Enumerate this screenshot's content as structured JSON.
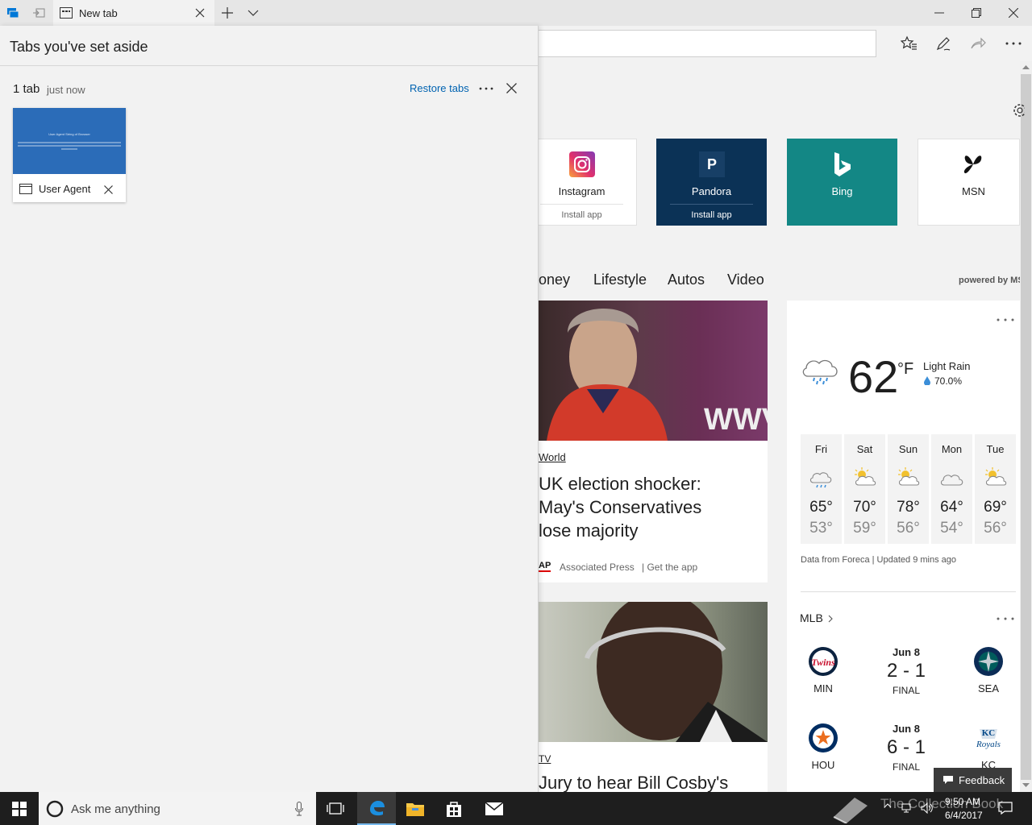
{
  "browser": {
    "tab_title": "New tab",
    "window_buttons": [
      "minimize",
      "restore",
      "close"
    ]
  },
  "aside_panel": {
    "title": "Tabs you've set aside",
    "group_count": "1 tab",
    "group_time": "just now",
    "restore_label": "Restore tabs",
    "more_label": "⋯",
    "thumbnail_title": "User Agent",
    "thumbnail_heading": "User Agent String of Browser"
  },
  "top_sites": [
    {
      "name": "Instagram",
      "sub": "Install app"
    },
    {
      "name": "Pandora",
      "sub": "Install app"
    },
    {
      "name": "Bing",
      "sub": ""
    },
    {
      "name": "MSN",
      "sub": ""
    }
  ],
  "news_nav": {
    "items": [
      "oney",
      "Lifestyle",
      "Autos",
      "Video"
    ],
    "powered_by": "powered by MS"
  },
  "articles": [
    {
      "category": "World",
      "headline_lines": [
        "UK election shocker:",
        "May's Conservatives",
        "lose majority"
      ],
      "source_logo": "AP",
      "source": "Associated Press",
      "get_app": "| Get the app"
    },
    {
      "category": "TV",
      "headline_lines": [
        "Jury to hear Bill Cosby's"
      ]
    }
  ],
  "weather": {
    "temp": "62",
    "unit": "°F",
    "condition": "Light Rain",
    "precip": "70.0%",
    "forecast": [
      {
        "day": "Fri",
        "icon": "rain-icon",
        "high": "65°",
        "low": "53°"
      },
      {
        "day": "Sat",
        "icon": "partly-sunny-icon",
        "high": "70°",
        "low": "59°"
      },
      {
        "day": "Sun",
        "icon": "partly-sunny-icon",
        "high": "78°",
        "low": "56°"
      },
      {
        "day": "Mon",
        "icon": "cloudy-icon",
        "high": "64°",
        "low": "54°"
      },
      {
        "day": "Tue",
        "icon": "partly-sunny-icon",
        "high": "69°",
        "low": "56°"
      }
    ],
    "footer": "Data from Foreca | Updated 9 mins ago"
  },
  "mlb": {
    "title": "MLB",
    "games": [
      {
        "date": "Jun 8",
        "score": "2 - 1",
        "status": "FINAL",
        "home": "MIN",
        "away": "SEA"
      },
      {
        "date": "Jun 8",
        "score": "6 - 1",
        "status": "FINAL",
        "home": "HOU",
        "away": "KC"
      }
    ]
  },
  "feedback_label": "Feedback",
  "taskbar": {
    "search_placeholder": "Ask me anything",
    "time": "9:50 AM",
    "date": "6/4/2017",
    "watermark": "The Collection Book"
  },
  "colors": {
    "accent": "#0078d7",
    "pandora": "#0b3256",
    "bing": "#138785",
    "link": "#0063b1"
  }
}
